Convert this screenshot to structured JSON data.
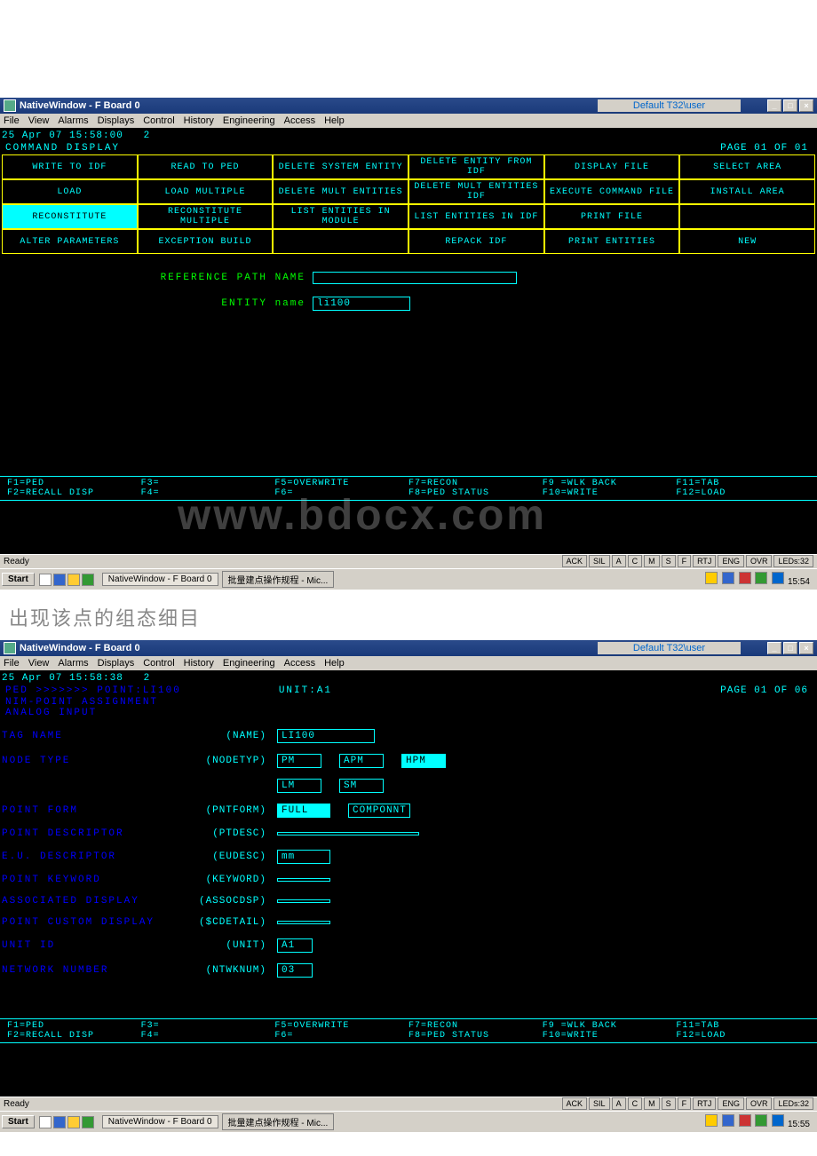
{
  "caption_text": "出现该点的组态细目",
  "watermark": "www.bdocx.com",
  "window1": {
    "title": "NativeWindow - F Board 0",
    "default_user": "Default T32\\user",
    "menus": [
      "File",
      "View",
      "Alarms",
      "Displays",
      "Control",
      "History",
      "Engineering",
      "Access",
      "Help"
    ],
    "timestamp": "25 Apr 07 15:58:00",
    "ts_suffix": "2",
    "header": "COMMAND DISPLAY",
    "page_info": "PAGE 01 OF 01",
    "grid": [
      [
        "WRITE TO IDF",
        "READ TO PED",
        "DELETE SYSTEM ENTITY",
        "DELETE ENTITY FROM IDF",
        "DISPLAY FILE",
        "SELECT AREA"
      ],
      [
        "LOAD",
        "LOAD MULTIPLE",
        "DELETE MULT ENTITIES",
        "DELETE MULT ENTITIES IDF",
        "EXECUTE COMMAND FILE",
        "INSTALL AREA"
      ],
      [
        "RECONSTITUTE",
        "RECONSTITUTE MULTIPLE",
        "LIST ENTITIES IN MODULE",
        "LIST ENTITIES IN IDF",
        "PRINT FILE",
        ""
      ],
      [
        "ALTER PARAMETERS",
        "EXCEPTION BUILD",
        "",
        "REPACK IDF",
        "PRINT ENTITIES",
        "NEW"
      ]
    ],
    "grid_selected": [
      2,
      0
    ],
    "ref_path_label": "REFERENCE PATH NAME",
    "ref_path_value": "",
    "entity_label": "ENTITY name",
    "entity_value": "li100",
    "fkeys": [
      [
        "F1=PED",
        "F3=",
        "F5=OVERWRITE",
        "F7=RECON",
        "F9 =WLK BACK",
        "F11=TAB"
      ],
      [
        "F2=RECALL DISP",
        "F4=",
        "F6=",
        "F8=PED STATUS",
        "F10=WRITE",
        "F12=LOAD"
      ]
    ],
    "status_ready": "Ready",
    "status_btns": [
      "ACK",
      "SIL",
      "A",
      "C",
      "M",
      "S",
      "F",
      "RTJ",
      "ENG",
      "OVR",
      "LEDs:32"
    ],
    "taskbar": {
      "start": "Start",
      "items": [
        "NativeWindow - F Board 0",
        "批量建点操作规程 - Mic..."
      ],
      "clock": "15:54"
    }
  },
  "window2": {
    "title": "NativeWindow - F Board 0",
    "default_user": "Default T32\\user",
    "menus": [
      "File",
      "View",
      "Alarms",
      "Displays",
      "Control",
      "History",
      "Engineering",
      "Access",
      "Help"
    ],
    "timestamp": "25 Apr 07 15:58:38",
    "ts_suffix": "2",
    "header_left": "PED >>>>>>> POINT:LI100",
    "header_mid": "UNIT:A1",
    "page_info": "PAGE 01 OF 06",
    "sub1": "NIM-POINT ASSIGNMENT",
    "sub2": " ANALOG INPUT",
    "rows": [
      {
        "label": "TAG NAME",
        "code": "(NAME)",
        "boxes": [
          {
            "v": "LI100",
            "w": 110
          }
        ]
      },
      {
        "label": "NODE TYPE",
        "code": "(NODETYP)",
        "boxes": [
          {
            "v": "PM",
            "w": 50
          },
          {
            "v": "APM",
            "w": 50
          },
          {
            "v": "HPM",
            "w": 50,
            "sel": true
          }
        ]
      },
      {
        "label": "",
        "code": "",
        "boxes": [
          {
            "v": "LM",
            "w": 50
          },
          {
            "v": "SM",
            "w": 50
          }
        ]
      },
      {
        "label": "POINT FORM",
        "code": "(PNTFORM)",
        "boxes": [
          {
            "v": "FULL",
            "w": 60,
            "sel": true
          },
          {
            "v": "COMPONNT",
            "w": 70
          }
        ]
      },
      {
        "label": "POINT DESCRIPTOR",
        "code": "(PTDESC)",
        "boxes": [
          {
            "v": "",
            "w": 160
          }
        ]
      },
      {
        "label": "E.U. DESCRIPTOR",
        "code": "(EUDESC)",
        "boxes": [
          {
            "v": "mm",
            "w": 60
          }
        ]
      },
      {
        "label": "POINT KEYWORD",
        "code": "(KEYWORD)",
        "boxes": [
          {
            "v": "",
            "w": 60
          }
        ]
      },
      {
        "label": "ASSOCIATED DISPLAY",
        "code": "(ASSOCDSP)",
        "boxes": [
          {
            "v": "",
            "w": 60
          }
        ]
      },
      {
        "label": "POINT CUSTOM DISPLAY",
        "code": "($CDETAIL)",
        "boxes": [
          {
            "v": "",
            "w": 60
          }
        ]
      },
      {
        "label": "UNIT ID",
        "code": "(UNIT)",
        "boxes": [
          {
            "v": "A1",
            "w": 24
          }
        ]
      },
      {
        "label": "NETWORK NUMBER",
        "code": "(NTWKNUM)",
        "boxes": [
          {
            "v": "03",
            "w": 24
          }
        ]
      }
    ],
    "fkeys": [
      [
        "F1=PED",
        "F3=",
        "F5=OVERWRITE",
        "F7=RECON",
        "F9 =WLK BACK",
        "F11=TAB"
      ],
      [
        "F2=RECALL DISP",
        "F4=",
        "F6=",
        "F8=PED STATUS",
        "F10=WRITE",
        "F12=LOAD"
      ]
    ],
    "status_ready": "Ready",
    "status_btns": [
      "ACK",
      "SIL",
      "A",
      "C",
      "M",
      "S",
      "F",
      "RTJ",
      "ENG",
      "OVR",
      "LEDs:32"
    ],
    "taskbar": {
      "start": "Start",
      "items": [
        "NativeWindow - F Board 0",
        "批量建点操作规程 - Mic..."
      ],
      "clock": "15:55"
    }
  }
}
